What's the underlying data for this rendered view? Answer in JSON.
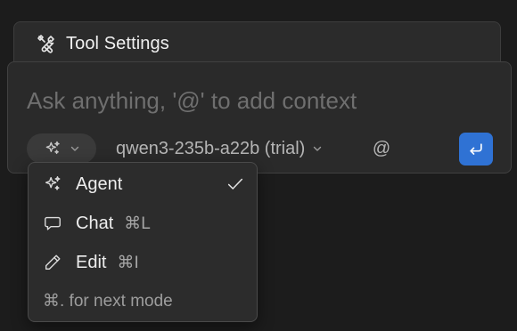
{
  "tool_settings": {
    "title": "Tool Settings",
    "icon": "tools-icon"
  },
  "composer": {
    "placeholder": "Ask anything, '@' to add context",
    "mode_icon": "sparkles-icon",
    "model_name": "qwen3-235b-a22b (trial)",
    "mention_label": "@",
    "send_icon": "enter-icon",
    "accent_color": "#2f72d4"
  },
  "mode_menu": {
    "items": [
      {
        "label": "Agent",
        "shortcut": "",
        "icon": "sparkles-icon",
        "selected": true
      },
      {
        "label": "Chat",
        "shortcut": "⌘L",
        "icon": "chat-bubble-icon",
        "selected": false
      },
      {
        "label": "Edit",
        "shortcut": "⌘I",
        "icon": "pencil-icon",
        "selected": false
      }
    ],
    "hint": "⌘. for next mode"
  }
}
